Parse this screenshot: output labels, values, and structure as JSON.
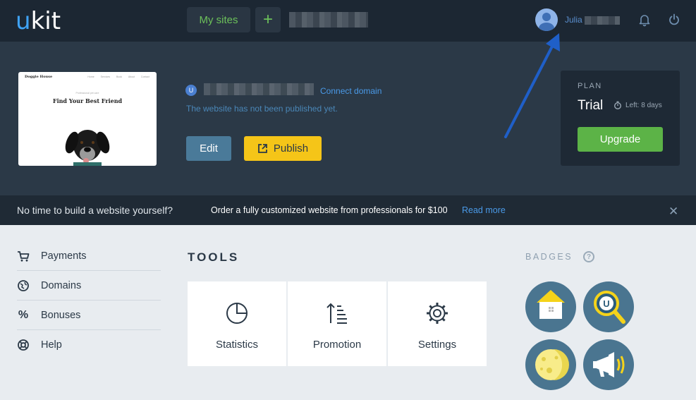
{
  "header": {
    "logo": {
      "u": "u",
      "rest": "kit"
    },
    "my_sites_label": "My sites",
    "add_label": "+",
    "user_name": "Julia"
  },
  "site": {
    "badge_letter": "U",
    "connect_domain": "Connect domain",
    "status": "The website has not been published yet.",
    "edit_label": "Edit",
    "publish_label": "Publish",
    "thumbnail": {
      "brand": "Doggie House",
      "nav": "Home Services Book About Contact",
      "subtitle": "Professional pet care",
      "title": "Find Your Best Friend"
    }
  },
  "plan": {
    "label": "PLAN",
    "name": "Trial",
    "left": "Left: 8 days",
    "upgrade_label": "Upgrade"
  },
  "banner": {
    "question": "No time to build a website yourself?",
    "offer": "Order a fully customized website from professionals for $100",
    "read_more": "Read more",
    "close": "✕"
  },
  "menu": [
    {
      "label": "Payments",
      "icon": "cart-icon"
    },
    {
      "label": "Domains",
      "icon": "globe-icon"
    },
    {
      "label": "Bonuses",
      "icon": "percent-icon"
    },
    {
      "label": "Help",
      "icon": "lifebuoy-icon"
    }
  ],
  "tools": {
    "title": "TOOLS",
    "items": [
      {
        "label": "Statistics",
        "icon": "pie-chart-icon"
      },
      {
        "label": "Promotion",
        "icon": "sort-ascending-icon"
      },
      {
        "label": "Settings",
        "icon": "gear-icon"
      }
    ]
  },
  "badges": {
    "title": "BADGES",
    "help": "?",
    "items": [
      "house-badge",
      "search-badge",
      "moon-badge",
      "megaphone-badge"
    ]
  },
  "colors": {
    "topbar": "#1c2733",
    "panel": "#2b3947",
    "accent_green": "#5cb347",
    "accent_yellow": "#f5c518",
    "link_blue": "#4a9ae8"
  }
}
